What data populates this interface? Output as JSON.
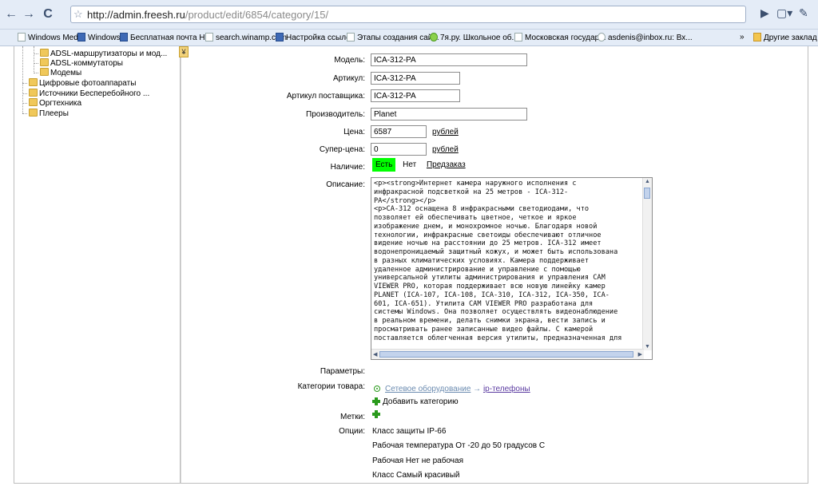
{
  "browser": {
    "url_host": "http://admin.freesh.ru",
    "url_path": "/product/edit/6854/category/15/",
    "bookmarks": [
      "Windows Media",
      "Windows",
      "Бесплатная почта Н...",
      "search.winamp.com",
      "Настройка ссылок",
      "Этапы создания сай...",
      "7я.ру. Школьное об...",
      "Московская государ...",
      "asdenis@inbox.ru: Вх...",
      "Другие заклад"
    ]
  },
  "tree": {
    "items": [
      "ADSL-маршрутизаторы и мод...",
      "ADSL-коммутаторы",
      "Модемы",
      "Цифровые фотоаппараты",
      "Источники Бесперебойного ...",
      "Оргтехника",
      "Плееры"
    ]
  },
  "form": {
    "model_label": "Модель:",
    "model_value": "ICA-312-PA",
    "article_label": "Артикул:",
    "article_value": "ICA-312-PA",
    "supplier_article_label": "Артикул поставщика:",
    "supplier_article_value": "ICA-312-PA",
    "manufacturer_label": "Производитель:",
    "manufacturer_value": "Planet",
    "price_label": "Цена:",
    "price_value": "6587",
    "price_currency": "рублей",
    "superprice_label": "Супер-цена:",
    "superprice_value": "0",
    "superprice_currency": "рублей",
    "availability_label": "Наличие:",
    "availability_yes": "Есть",
    "availability_no": "Нет",
    "availability_preorder": "Предзаказ",
    "description_label": "Описание:",
    "description_text": "<p><strong>Интернет камера наружного исполнения с\nинфракрасной подсветкой на 25 метров - ICA-312-\nPA</strong></p>\n<p>CA-312 оснащена 8 инфракрасными светодиодами, что\nпозволяет ей обеспечивать цветное, четкое и яркое\nизображение днем, и монохромное ночью. Благодаря новой\nтехнологии, инфракрасные светоиды обеспечивают отличное\nвидение ночью на расстоянии до 25 метров. ICA-312 имеет\nводонепроницаемый защитный кожух, и может быть использована\nв разных климатических условиях. Камера поддерживает\nудаленное администрирование и управление с помощью\nуниверсальной утилиты администрирования и управления CAM\nVIEWER PRO, которая поддерживает всю новую линейку камер\nPLANET (ICA-107, ICA-108, ICA-310, ICA-312, ICA-350, ICA-\n601, ICA-651). Утилита CAM VIEWER PRO разработана для\nсистемы Windows. Она позволяет осуществлять видеонаблюдение\nв реальном времени, делать снимки экрана, вести запись и\nпросматривать ранее записанные видео файлы. С камерой\nпоставляется облегченная версия утилиты, предназначенная для",
    "params_label": "Параметры:",
    "categories_label": "Категории товара:",
    "category_parent": "Сетевое оборудование",
    "category_arrow": "→",
    "category_child": "ip-телефоны",
    "add_category": "Добавить категорию",
    "tags_label": "Метки:",
    "options_label": "Опции:",
    "options": [
      "Класс защиты IP-66",
      "Рабочая температура От -20 до 50 градусов С",
      "Рабочая Нет не рабочая",
      "Класс Самый красивый"
    ]
  }
}
